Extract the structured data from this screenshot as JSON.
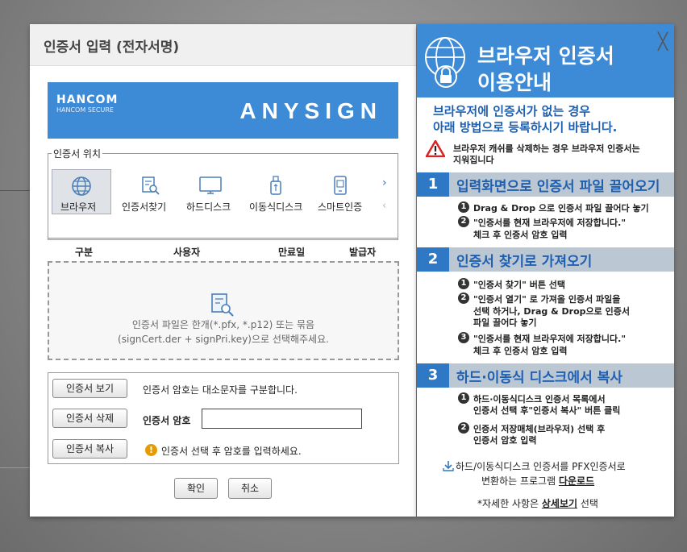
{
  "dialog": {
    "title": "인증서 입력 (전자서명)",
    "banner": {
      "brand": "HANCOM",
      "brand_sub": "HANCOM SECURE",
      "product": "ANYSIGN"
    },
    "location": {
      "legend": "인증서 위치",
      "items": [
        {
          "label": "브라우저",
          "icon": "globe-icon",
          "selected": true
        },
        {
          "label": "인증서찾기",
          "icon": "certificate-search-icon"
        },
        {
          "label": "하드디스크",
          "icon": "monitor-icon"
        },
        {
          "label": "이동식디스크",
          "icon": "usb-icon"
        },
        {
          "label": "스마트인증",
          "icon": "smartphone-icon"
        }
      ]
    },
    "table": {
      "headers": [
        "구분",
        "사용자",
        "만료일",
        "발급자"
      ],
      "empty_line1": "인증서 파일은 한개(*.pfx, *.p12) 또는 묶음",
      "empty_line2": "(signCert.der + signPri.key)으로 선택해주세요."
    },
    "actions": {
      "view_button": "인증서 보기",
      "delete_button": "인증서 삭제",
      "copy_button": "인증서 복사",
      "case_notice": "인증서 암호는 대소문자를 구분합니다.",
      "password_label": "인증서 암호",
      "password_value": "",
      "warning_text": "인증서 선택 후 암호를 입력하세요.",
      "warning_icon": "!"
    },
    "ok_button": "확인",
    "cancel_button": "취소"
  },
  "guide": {
    "title_line1": "브라우저 인증서",
    "title_line2": "이용안내",
    "close": "╳",
    "intro_line1": "브라우저에 인증서가 없는 경우",
    "intro_line2": "아래 방법으로 등록하시기 바랍니다.",
    "warning_line1": "브라우저 캐쉬를 삭제하는 경우 브라우저 인증서는",
    "warning_line2": "지워집니다",
    "sections": [
      {
        "num": "1",
        "title": "입력화면으로 인증서 파일 끌어오기",
        "steps": [
          {
            "num": "1",
            "lines": [
              "Drag & Drop 으로 인증서 파일 끌어다 놓기"
            ]
          },
          {
            "num": "2",
            "lines": [
              "\"인증서를 현재 브라우저에 저장합니다.\"",
              "체크 후 인증서 암호 입력"
            ]
          }
        ]
      },
      {
        "num": "2",
        "title": "인증서 찾기로 가져오기",
        "steps": [
          {
            "num": "1",
            "lines": [
              "\"인증서 찾기\" 버튼 선택"
            ]
          },
          {
            "num": "2",
            "lines": [
              "\"인증서 열기\" 로 가져올 인증서 파일을",
              "선택 하거나, Drag & Drop으로 인증서",
              "파일 끌어다 놓기"
            ]
          },
          {
            "num": "3",
            "lines": [
              "\"인증서를 현재 브라우저에 저장합니다.\"",
              "체크 후 인증서 암호 입력"
            ]
          }
        ]
      },
      {
        "num": "3",
        "title": "하드·이동식 디스크에서 복사",
        "steps": [
          {
            "num": "1",
            "lines": [
              "하드·이동식디스크 인증서 목록에서",
              "인증서 선택 후\"인증서 복사\" 버튼 클릭"
            ]
          },
          {
            "num": "2",
            "lines": [
              "인증서 저장매체(브라우저) 선택 후",
              "인증서 암호 입력"
            ]
          }
        ]
      }
    ],
    "download_line1": "하드/이동식디스크 인증서를 PFX인증서로",
    "download_line2_prefix": "변환하는 프로그램 ",
    "download_link": "다운로드",
    "detail_prefix": "*자세한 사항은 ",
    "detail_link": "상세보기",
    "detail_suffix": " 선택"
  },
  "colors": {
    "accent": "#3d8ad6",
    "accent_dark": "#2f78c6",
    "section_bg": "#bcc7d4",
    "link_blue": "#1e5fb0"
  }
}
